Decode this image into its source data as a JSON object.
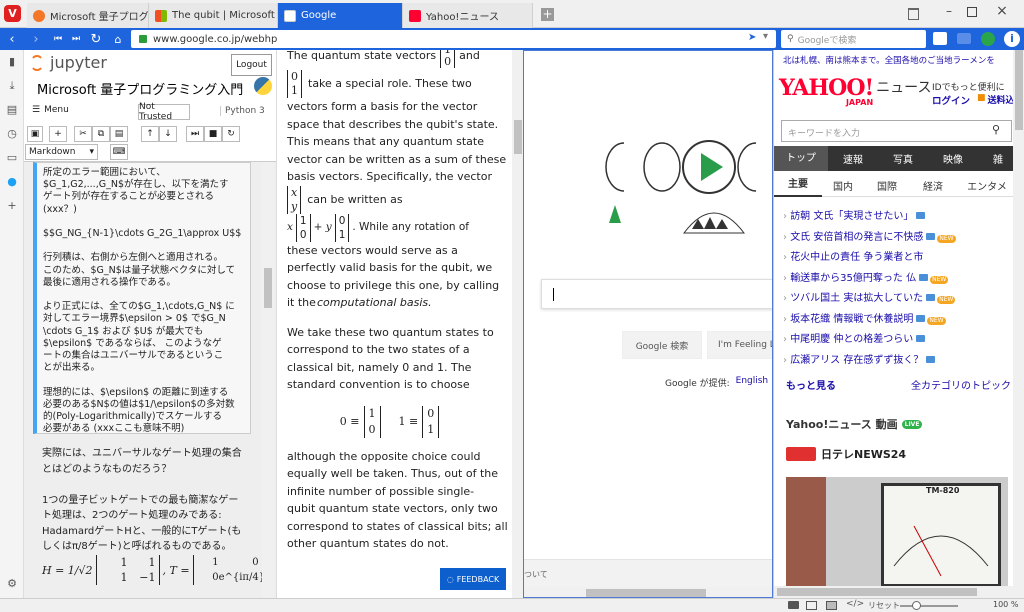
{
  "tabs": [
    {
      "title": "Microsoft 量子プログラミング入門",
      "icon": "jupyter-icon",
      "color": "#f37726"
    },
    {
      "title": "The qubit | Microsoft Docs",
      "icon": "microsoft-icon",
      "color": "#00a4ef"
    },
    {
      "title": "Google",
      "icon": "google-icon",
      "color": "#ffffff",
      "active": true
    },
    {
      "title": "Yahoo!ニュース",
      "icon": "yahoo-icon",
      "color": "#ff0033"
    }
  ],
  "address": {
    "url": "www.google.co.jp/webhp",
    "search_placeholder": "Googleで検索"
  },
  "jupyter": {
    "logo": "jupyter",
    "logout": "Logout",
    "title": "Microsoft 量子プログラミング入門",
    "menu": "Menu",
    "trusted": "Not Trusted",
    "kernel": "Python 3",
    "cell_type": "Markdown",
    "cell1": [
      "所定のエラー範囲において、",
      "$G_1,G2,...,G_N$が存在し、以下を満たす",
      "ゲート列が存在することが必要とされる",
      "(xxx？)",
      "",
      "$$G_NG_{N-1}\\cdots G_2G_1\\approx U$$",
      "",
      "行列積は、右側から左側へと適用される。",
      "このため、$G_N$は量子状態ベクタに対して",
      "最後に適用される操作である。",
      "",
      "より正式には、全ての$G_1,\\cdots,G_N$ に",
      "対してエラー境界$\\epsilon > 0$ で$G_N",
      "\\cdots G_1$ および $U$ が最大でも",
      "$\\epsilon$ であるならば、 このようなゲ",
      "ートの集合はユニバーサルであるというこ",
      "とが出来る。",
      "",
      "理想的には、$\\epsilon$ の距離に到達する",
      "必要のある$N$の値は$1/\\epsilon$の多対数",
      "的(Poly-Logarithmically)でスケールする",
      "必要がある (xxxここも意味不明)"
    ],
    "cell2": [
      "実際には、ユニバーサルなゲート処理の集合",
      "とはどのようなものだろう？",
      "",
      "1つの量子ビットゲートでの最も簡潔なゲー",
      "ト処理は、2つのゲート処理のみである:",
      "HadamardゲートHと、一般的にTゲート(も",
      "しくはπ/8ゲート)と呼ばれるものである。"
    ],
    "formula_h": "H = 1/√2",
    "formula_h_m": [
      "1",
      "1",
      "1",
      "−1"
    ],
    "formula_t": ", T =",
    "formula_t_m": [
      "1",
      "0",
      "0",
      "e^{iπ/4}"
    ]
  },
  "docs": {
    "top_line": "The quantum state vectors",
    "top_and": "and",
    "vec_top_0": [
      "1",
      "0"
    ],
    "vec_top_1": [
      "0",
      "1"
    ],
    "p1a": "take a special role. These two",
    "p1": [
      "vectors form a basis for the vector",
      "space that describes the qubit's state.",
      "This means that any quantum state",
      "vector can be written as a sum of these",
      "basis vectors. Specifically, the vector"
    ],
    "vec_xy": [
      "x",
      "y"
    ],
    "can_be": "can be written as",
    "lin_x": "x",
    "lin_plus": "+ y",
    "while": ". While any rotation of",
    "p2": [
      "these vectors would serve as a",
      "perfectly valid basis for the qubit, we",
      "choose to privilege this one, by calling",
      "it the"
    ],
    "comp_basis": "computational basis.",
    "p3": [
      "We take these two quantum states to",
      "correspond to the two states of a",
      "classical bit, namely 0 and 1. The",
      "standard convention is to choose"
    ],
    "eq0": "0 ≡",
    "eq1": "1 ≡",
    "p4": [
      "although the opposite choice could",
      "equally well be taken. Thus, out of the",
      "infinite number of possible single-",
      "qubit quantum state vectors, only two",
      "correspond to states of classical bits; all",
      "other quantum states do not."
    ],
    "feedback": "FEEDBACK"
  },
  "google": {
    "search_btn": "Google 検索",
    "lucky_btn": "I'm Feeling L",
    "offered": "Google が提供:",
    "english": "English",
    "footer_cut": "ついて"
  },
  "yahoo": {
    "top_notice": "北は札幌、南は熊本まで。全国各地のご当地ラーメンを",
    "logo": "YAHOO!",
    "logo_sub": "JAPAN",
    "logo_news": "ニュース",
    "id_text": "IDでもっと便利に",
    "login": "ログイン",
    "send": "送料込",
    "search_placeholder": "キーワードを入力",
    "nav": [
      "トップ",
      "速報",
      "写真",
      "映像",
      "雑"
    ],
    "subnav": [
      "主要",
      "国内",
      "国際",
      "経済",
      "エンタメ"
    ],
    "news": [
      {
        "text": "訪朝 文氏「実現させたい」",
        "cam": true,
        "new": false
      },
      {
        "text": "文氏 安倍首相の発言に不快感",
        "cam": true,
        "new": true
      },
      {
        "text": "花火中止の責任 争う業者と市",
        "cam": false,
        "new": false
      },
      {
        "text": "輸送車から35億円奪った 仏",
        "cam": true,
        "new": true
      },
      {
        "text": "ツバル国土 実は拡大していた",
        "cam": true,
        "new": true
      },
      {
        "text": "坂本花織 情報戦で休養説明",
        "cam": true,
        "new": true
      },
      {
        "text": "中尾明慶 仲との格差つらい",
        "cam": true,
        "new": false
      },
      {
        "text": "広瀬アリス 存在感ずず抜く？",
        "cam": true,
        "new": false
      }
    ],
    "more": "もっと見る",
    "all_topics": "全カテゴリのトピック",
    "video_title": "Yahoo!ニュース 動画",
    "live": "LIVE",
    "channel": "日テレNEWS24",
    "meter_brand": "TM-820"
  },
  "status": {
    "reset": "リセット",
    "zoom": "100 %"
  }
}
